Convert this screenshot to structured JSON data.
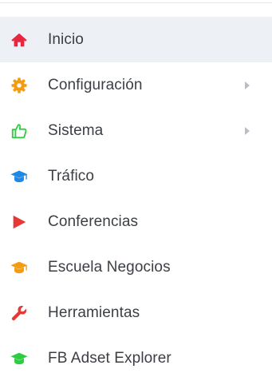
{
  "colors": {
    "active_bg": "#edf1f6",
    "text": "#3b3f45",
    "home": "#e9263f",
    "config": "#f39c12",
    "sistema": "#2ecc40",
    "trafico": "#1e88e5",
    "conferencias": "#e53935",
    "escuela": "#f39c12",
    "herramientas": "#e53935",
    "chevron": "#b9bec6"
  },
  "menu": {
    "items": [
      {
        "label": "Inicio",
        "icon": "home-icon",
        "active": true
      },
      {
        "label": "Configuración",
        "icon": "gear-icon",
        "submenu": true
      },
      {
        "label": "Sistema",
        "icon": "thumbs-up-icon",
        "submenu": true
      },
      {
        "label": "Tráfico",
        "icon": "graduation-cap-icon"
      },
      {
        "label": "Conferencias",
        "icon": "play-icon"
      },
      {
        "label": "Escuela Negocios",
        "icon": "graduation-cap-icon"
      },
      {
        "label": "Herramientas",
        "icon": "wrench-icon"
      },
      {
        "label": "FB Adset Explorer",
        "icon": "graduation-cap-icon",
        "partially_visible": true
      }
    ]
  }
}
